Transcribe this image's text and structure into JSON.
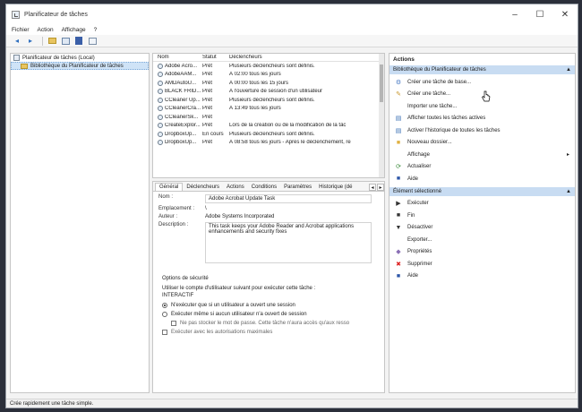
{
  "window": {
    "title": "Planificateur de tâches",
    "minimize": "‒",
    "maximize": "☐",
    "close": "✕"
  },
  "menu": [
    "Fichier",
    "Action",
    "Affichage",
    "?"
  ],
  "toolbar": {
    "back_icon": "◂",
    "forward_icon": "▸"
  },
  "tree": {
    "root": "Planificateur de tâches (Local)",
    "library": "Bibliothèque du Planificateur de tâches"
  },
  "task_list": {
    "columns": [
      "Nom",
      "Statut",
      "Déclencheurs"
    ],
    "rows": [
      {
        "name": "Adobe Acro...",
        "status": "Prêt",
        "trigger": "Plusieurs déclencheurs sont définis."
      },
      {
        "name": "AdobeAAM...",
        "status": "Prêt",
        "trigger": "À 02:00 tous les jours"
      },
      {
        "name": "AMDAutoU...",
        "status": "Prêt",
        "trigger": "À 00:00 tous les 15 jours"
      },
      {
        "name": "BLACK FRID...",
        "status": "Prêt",
        "trigger": "À l'ouverture de session d'un utilisateur"
      },
      {
        "name": "CCleaner Up...",
        "status": "Prêt",
        "trigger": "Plusieurs déclencheurs sont définis."
      },
      {
        "name": "CCleanerCra...",
        "status": "Prêt",
        "trigger": "À 13:49 tous les jours"
      },
      {
        "name": "CCleanerSk...",
        "status": "Prêt",
        "trigger": ""
      },
      {
        "name": "CreateExplor...",
        "status": "Prêt",
        "trigger": "Lors de la création ou de la modification de la tâc"
      },
      {
        "name": "DropboxUp...",
        "status": "En cours",
        "trigger": "Plusieurs déclencheurs sont définis."
      },
      {
        "name": "DropboxUp...",
        "status": "Prêt",
        "trigger": "À 08:58 tous les jours - Après le déclenchement, re"
      }
    ]
  },
  "details": {
    "tabs": [
      "Général",
      "Déclencheurs",
      "Actions",
      "Conditions",
      "Paramètres",
      "Historique (dé"
    ],
    "tab_prev": "◂",
    "tab_next": "▸",
    "name_label": "Nom :",
    "name_value": "Adobe Acrobat Update Task",
    "location_label": "Emplacement :",
    "location_value": "\\",
    "author_label": "Auteur :",
    "author_value": "Adobe Systems Incorporated",
    "description_label": "Description :",
    "description_value": "This task keeps your Adobe Reader and Acrobat applications enhancements and security fixes",
    "security": {
      "title": "Options de sécurité",
      "account_line": "Utiliser le compte d'utilisateur suivant pour exécuter cette tâche :",
      "account_value": "INTERACTIF",
      "radio1": "N'exécuter que si un utilisateur a ouvert une session",
      "radio2": "Exécuter même si aucun utilisateur n'a ouvert de session",
      "no_password": "Ne pas stocker le mot de passe. Cette tâche n'aura accès qu'aux resso",
      "highest": "Exécuter avec les autorisations maximales"
    }
  },
  "actions": {
    "title": "Actions",
    "section1": "Bibliothèque du Planificateur de tâches",
    "items1": [
      {
        "label": "Créer une tâche de base...",
        "icon": "create-basic-task-icon"
      },
      {
        "label": "Créer une tâche...",
        "icon": "create-task-icon"
      },
      {
        "label": "Importer une tâche...",
        "icon": "import-icon"
      },
      {
        "label": "Afficher toutes les tâches actives",
        "icon": "running-tasks-icon"
      },
      {
        "label": "Activer l'historique de toutes les tâches",
        "icon": "history-icon"
      },
      {
        "label": "Nouveau dossier...",
        "icon": "new-folder-icon"
      },
      {
        "label": "Affichage",
        "icon": "view-icon"
      },
      {
        "label": "Actualiser",
        "icon": "refresh-icon"
      },
      {
        "label": "Aide",
        "icon": "help-icon"
      }
    ],
    "section2": "Élément sélectionné",
    "items2": [
      {
        "label": "Exécuter",
        "icon": "run-icon"
      },
      {
        "label": "Fin",
        "icon": "end-icon"
      },
      {
        "label": "Désactiver",
        "icon": "disable-icon"
      },
      {
        "label": "Exporter...",
        "icon": "export-icon"
      },
      {
        "label": "Propriétés",
        "icon": "properties-icon"
      },
      {
        "label": "Supprimer",
        "icon": "delete-icon"
      },
      {
        "label": "Aide",
        "icon": "help-icon"
      }
    ]
  },
  "status_bar": "Crée rapidement une tâche simple."
}
